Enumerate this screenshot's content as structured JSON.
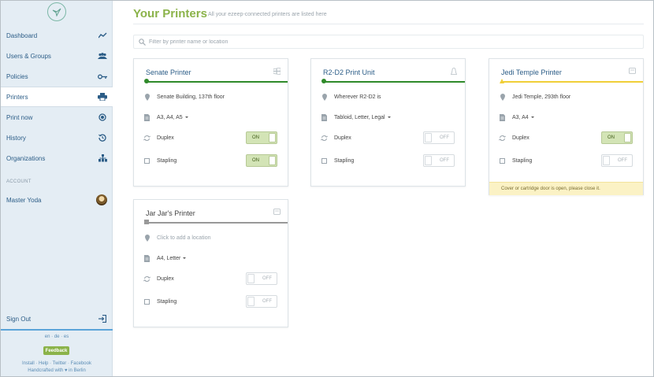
{
  "sidebar": {
    "items": [
      {
        "label": "Dashboard",
        "icon": "chart-line-icon"
      },
      {
        "label": "Users & Groups",
        "icon": "users-icon"
      },
      {
        "label": "Policies",
        "icon": "key-icon"
      },
      {
        "label": "Printers",
        "icon": "printer-icon"
      },
      {
        "label": "Print now",
        "icon": "record-icon"
      },
      {
        "label": "History",
        "icon": "history-icon"
      },
      {
        "label": "Organizations",
        "icon": "organization-icon"
      }
    ],
    "section_account": "ACCOUNT",
    "user_name": "Master Yoda",
    "sign_out": "Sign Out",
    "langs": {
      "en": "en",
      "de": "de",
      "es": "es",
      "sep": "·"
    },
    "feedback": "Feedback",
    "links": {
      "install": "Install",
      "help": "Help",
      "twitter": "Twitter",
      "facebook": "Facebook",
      "sep": "·"
    },
    "credit_pre": "Handcrafted with",
    "credit_heart": "♥",
    "credit_post": "in Berlin"
  },
  "header": {
    "title": "Your Printers",
    "subtitle": "All your ezeep-connected printers are listed here"
  },
  "filter": {
    "placeholder": "Filter by printer name or location"
  },
  "colors": {
    "accent_green": "#8bb34a",
    "status_ok": "#2f8a2a",
    "status_warn": "#f0cf38",
    "status_offline": "#999999",
    "nav_text": "#2c5d87"
  },
  "printers": [
    {
      "name": "Senate Printer",
      "status": "ok",
      "location": "Senate Building, 137th floor",
      "paper": "A3, A4, A5",
      "duplex_label": "Duplex",
      "duplex_state": "ON",
      "stapling_label": "Stapling",
      "stapling_state": "ON"
    },
    {
      "name": "R2-D2 Print Unit",
      "status": "ok",
      "location": "Wherever R2-D2 is",
      "paper": "Tabloid, Letter, Legal",
      "duplex_label": "Duplex",
      "duplex_state": "OFF",
      "stapling_label": "Stapling",
      "stapling_state": "OFF"
    },
    {
      "name": "Jedi Temple Printer",
      "status": "warning",
      "location": "Jedi Temple, 293th floor",
      "paper": "A3, A4",
      "duplex_label": "Duplex",
      "duplex_state": "ON",
      "stapling_label": "Stapling",
      "stapling_state": "OFF",
      "warning": "Cover or cartridge door is open, please close it."
    },
    {
      "name": "Jar Jar's Printer",
      "status": "offline",
      "location": "Click to add a location",
      "paper": "A4, Letter",
      "duplex_label": "Duplex",
      "duplex_state": "OFF",
      "stapling_label": "Stapling",
      "stapling_state": "OFF"
    }
  ]
}
